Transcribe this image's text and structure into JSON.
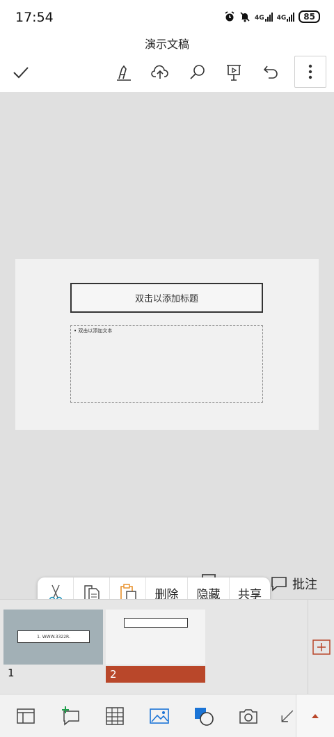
{
  "status_bar": {
    "time": "17:54",
    "network_1": "4G",
    "network_2": "4G",
    "battery": "85"
  },
  "header": {
    "title": "演示文稿",
    "icons": [
      "checkmark-icon",
      "pen-icon",
      "cloud-upload-icon",
      "search-icon",
      "present-icon",
      "undo-icon",
      "more-vertical-icon"
    ]
  },
  "slide": {
    "title_placeholder": "双击以添加标题",
    "body_placeholder": "双击以添加文本",
    "bullet": "•"
  },
  "context_menu": {
    "items": [
      {
        "icon": "scissors-icon"
      },
      {
        "icon": "copy-icon"
      },
      {
        "icon": "paste-icon"
      },
      {
        "label": "删除"
      },
      {
        "label": "隐藏"
      },
      {
        "label": "共享"
      }
    ]
  },
  "comment_button": {
    "label": "批注"
  },
  "thumbnails": [
    {
      "number": "1",
      "inner_text": "1.  WWW.3322R."
    },
    {
      "number": "2",
      "selected": true
    }
  ],
  "colors": {
    "accent": "#b9472a",
    "canvas": "#e0e0e0",
    "slide_bg": "#f1f1f1",
    "thumb1_bg": "#a2b0b6",
    "icon_blue": "#1b74d6",
    "icon_green": "#1e9e4a",
    "icon_orange": "#e8902a"
  },
  "bottom_bar": {
    "icons": [
      "layout-icon",
      "new-comment-icon",
      "table-icon",
      "picture-icon",
      "shapes-icon",
      "camera-icon",
      "draw-arrow-icon"
    ],
    "expand_icon": "triangle-up-icon"
  }
}
